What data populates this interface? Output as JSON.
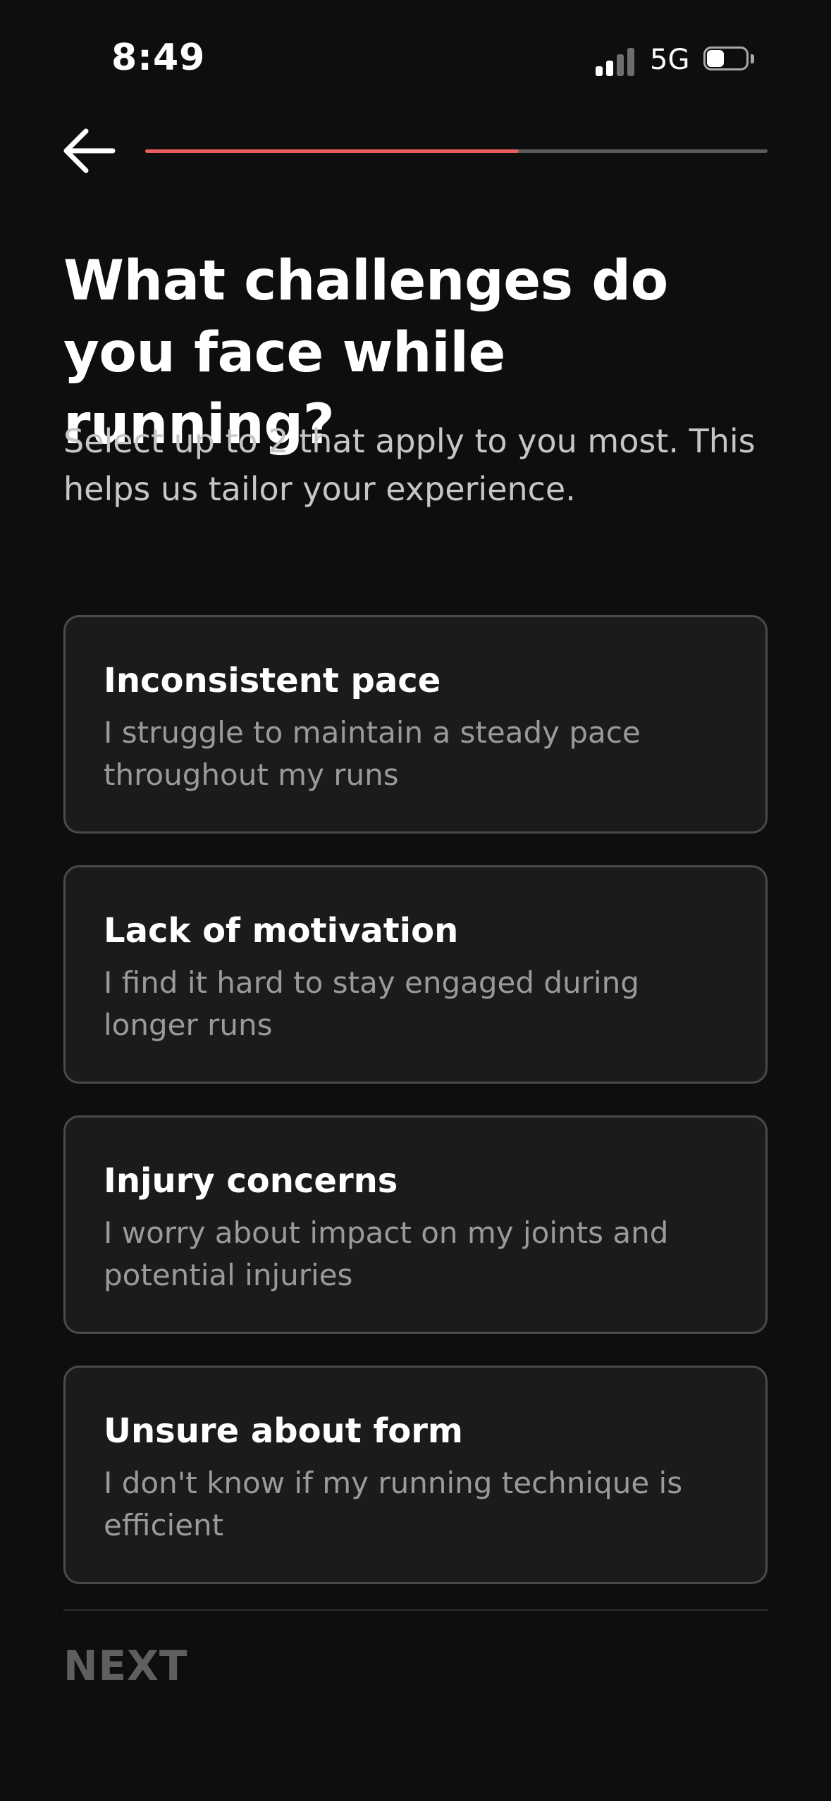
{
  "status_bar": {
    "time": "8:49",
    "network": "5G",
    "signal_icon": "cellular-signal-icon",
    "battery_icon": "battery-icon"
  },
  "header": {
    "back_icon": "arrow-left-icon",
    "progress_fraction": 0.6
  },
  "page": {
    "title": "What challenges do you face while running?",
    "subtitle": "Select up to 2 that apply to you most. This helps us tailor your experience."
  },
  "options": [
    {
      "title": "Inconsistent pace",
      "description": "I struggle to maintain a steady pace throughout my runs"
    },
    {
      "title": "Lack of motivation",
      "description": "I find it hard to stay engaged during longer runs"
    },
    {
      "title": "Injury concerns",
      "description": "I worry about impact on my joints and potential injuries"
    },
    {
      "title": "Unsure about form",
      "description": "I don't know if my running technique is efficient"
    }
  ],
  "footer": {
    "next_label": "NEXT"
  },
  "colors": {
    "background": "#0e0e0e",
    "accent": "#e65e5e",
    "card_background": "#1b1b1b",
    "card_border": "#4a4a4a",
    "disabled_text": "#5f5f5f"
  }
}
